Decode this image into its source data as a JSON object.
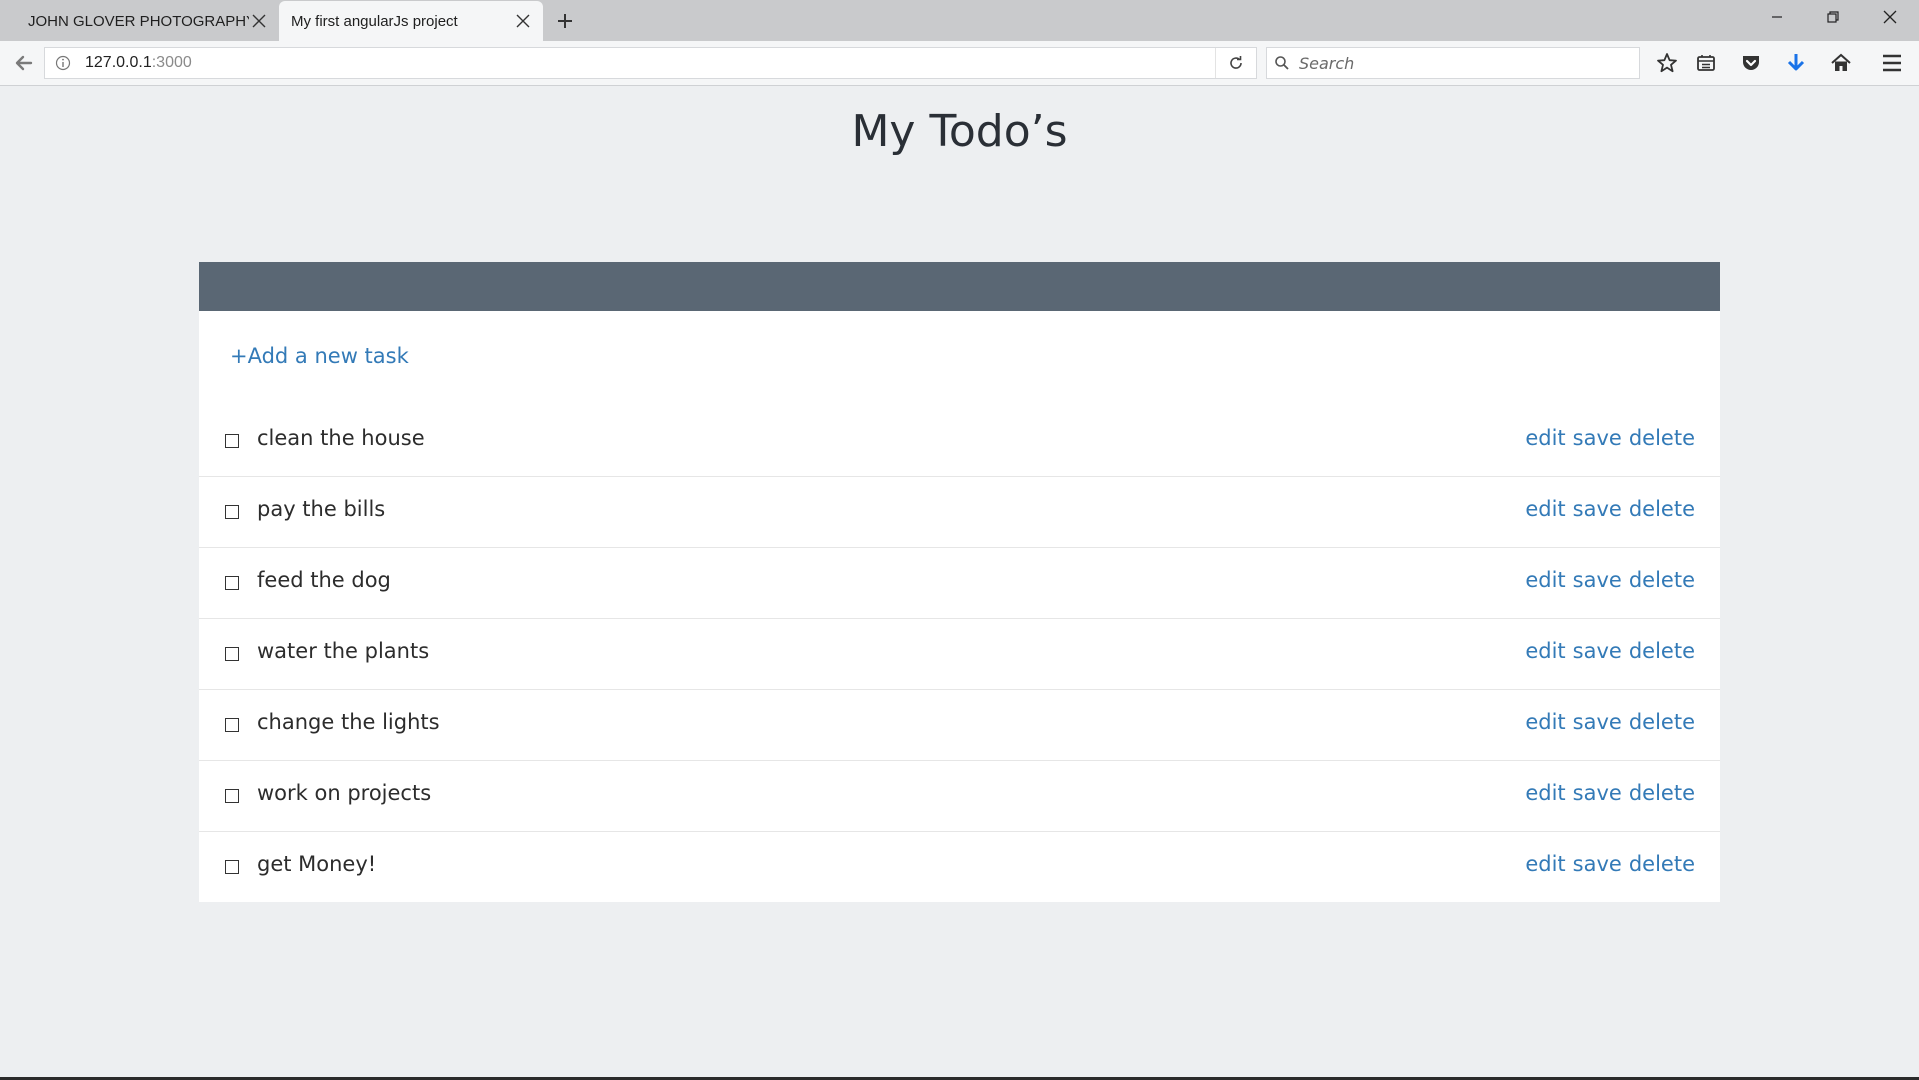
{
  "browser": {
    "tabs": [
      {
        "title": "JOHN GLOVER PHOTOGRAPHY",
        "active": false
      },
      {
        "title": "My first angularJs project",
        "active": true
      }
    ],
    "url_host": "127.0.0.1",
    "url_port": ":3000",
    "search_placeholder": "Search",
    "accent_color": "#1a73e8"
  },
  "page": {
    "title": "My Todo’s",
    "add_task_label": "+Add a new task",
    "link_color": "#337ab7",
    "header_color": "#5a6774"
  },
  "todos": [
    {
      "text": "clean the house",
      "done": false
    },
    {
      "text": "pay the bills",
      "done": false
    },
    {
      "text": "feed the dog",
      "done": false
    },
    {
      "text": "water the plants",
      "done": false
    },
    {
      "text": "change the lights",
      "done": false
    },
    {
      "text": "work on projects",
      "done": false
    },
    {
      "text": "get Money!",
      "done": false
    }
  ],
  "actions": {
    "edit": "edit",
    "save": "save",
    "delete": "delete"
  }
}
